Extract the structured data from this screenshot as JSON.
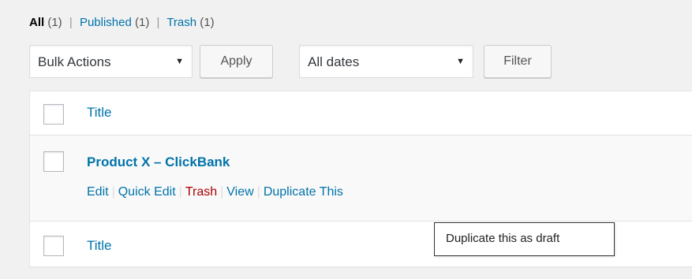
{
  "filters": {
    "all_label": "All",
    "all_count": "(1)",
    "published_label": "Published",
    "published_count": "(1)",
    "trash_label": "Trash",
    "trash_count": "(1)",
    "separator": "|"
  },
  "tablenav": {
    "bulk_actions": "Bulk Actions",
    "apply_label": "Apply",
    "dates_filter": "All dates",
    "filter_label": "Filter",
    "dropdown_icon": "triangle-down-icon",
    "dropdown_glyph": "▼"
  },
  "table": {
    "header_title": "Title",
    "footer_title": "Title",
    "rows": [
      {
        "title": "Product X – ClickBank",
        "actions": {
          "edit": "Edit",
          "quick_edit": "Quick Edit",
          "trash": "Trash",
          "view": "View",
          "duplicate": "Duplicate This"
        }
      }
    ],
    "action_separator": "|"
  },
  "tooltip": {
    "text": "Duplicate this as draft"
  },
  "colors": {
    "link": "#0073aa",
    "trash_link": "#a00000",
    "background": "#f1f1f1"
  }
}
